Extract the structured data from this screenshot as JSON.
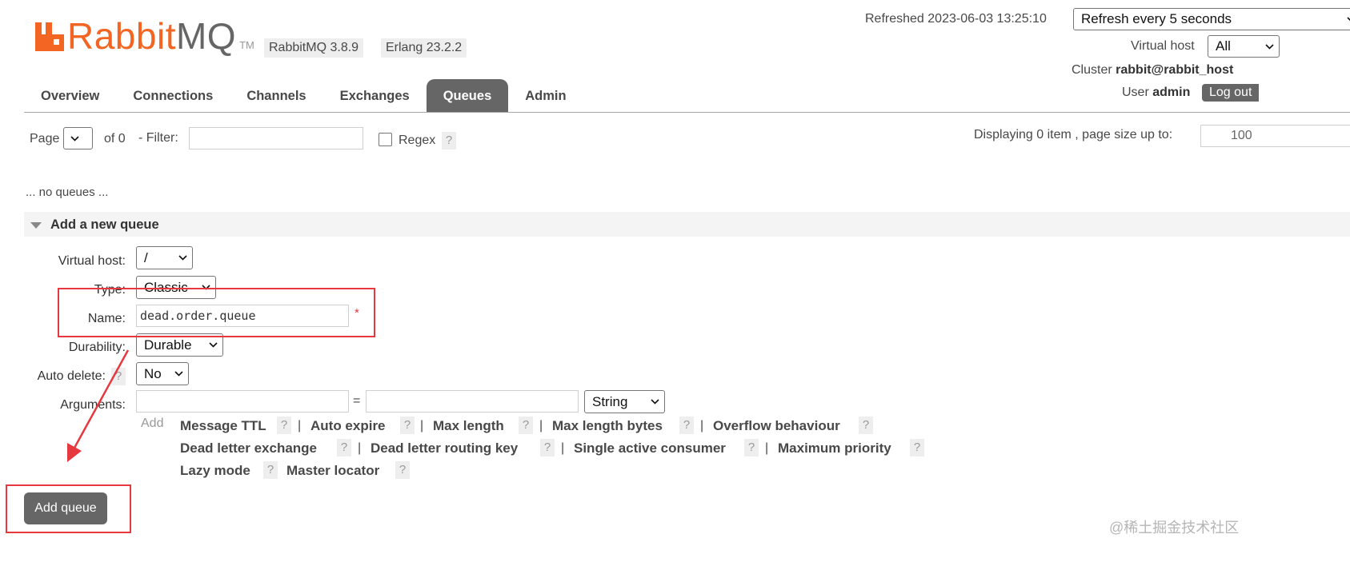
{
  "header": {
    "logo_rabbit": "Rabbit",
    "logo_mq": "MQ",
    "logo_tm": "TM",
    "version_badge": "RabbitMQ 3.8.9",
    "erlang_badge": "Erlang 23.2.2",
    "refreshed_label": "Refreshed 2023-06-03 13:25:10",
    "refresh_select": "Refresh every 5 seconds",
    "vhost_label": "Virtual host",
    "vhost_select": "All",
    "cluster_label": "Cluster",
    "cluster_value": "rabbit@rabbit_host",
    "user_label": "User",
    "user_value": "admin",
    "logout_label": "Log out"
  },
  "tabs": [
    {
      "label": "Overview"
    },
    {
      "label": "Connections"
    },
    {
      "label": "Channels"
    },
    {
      "label": "Exchanges"
    },
    {
      "label": "Queues"
    },
    {
      "label": "Admin"
    }
  ],
  "filter": {
    "page_label": "Page",
    "of_label": "of 0",
    "filter_label": "- Filter:",
    "filter_value": "",
    "regex_label": "Regex",
    "help": "?",
    "displaying": "Displaying 0 item , page size up to:",
    "page_size": "100"
  },
  "empty_message": "... no queues ...",
  "add_queue": {
    "section_title": "Add a new queue",
    "vhost_label": "Virtual host:",
    "vhost_value": "/",
    "type_label": "Type:",
    "type_value": "Classic",
    "name_label": "Name:",
    "name_value": "dead.order.queue",
    "required_mark": "*",
    "durability_label": "Durability:",
    "durability_value": "Durable",
    "autodelete_label": "Auto delete:",
    "autodelete_value": "No",
    "arguments_label": "Arguments:",
    "equals": "=",
    "arg_type_value": "String",
    "add_label": "Add",
    "help": "?",
    "sep": "|",
    "args": [
      "Message TTL",
      "Auto expire",
      "Max length",
      "Max length bytes",
      "Overflow behaviour",
      "Dead letter exchange",
      "Dead letter routing key",
      "Single active consumer",
      "Maximum priority",
      "Lazy mode",
      "Master locator"
    ],
    "submit_label": "Add queue"
  },
  "watermark": "@稀土掘金技术社区",
  "colors": {
    "brand_orange": "#f26522",
    "tab_active_bg": "#666666",
    "annotation_red": "#e6393f"
  },
  "icons": [
    "rabbitmq-logo-icon",
    "chevron-down-icon",
    "collapse-triangle-icon",
    "annotation-arrow-icon"
  ]
}
